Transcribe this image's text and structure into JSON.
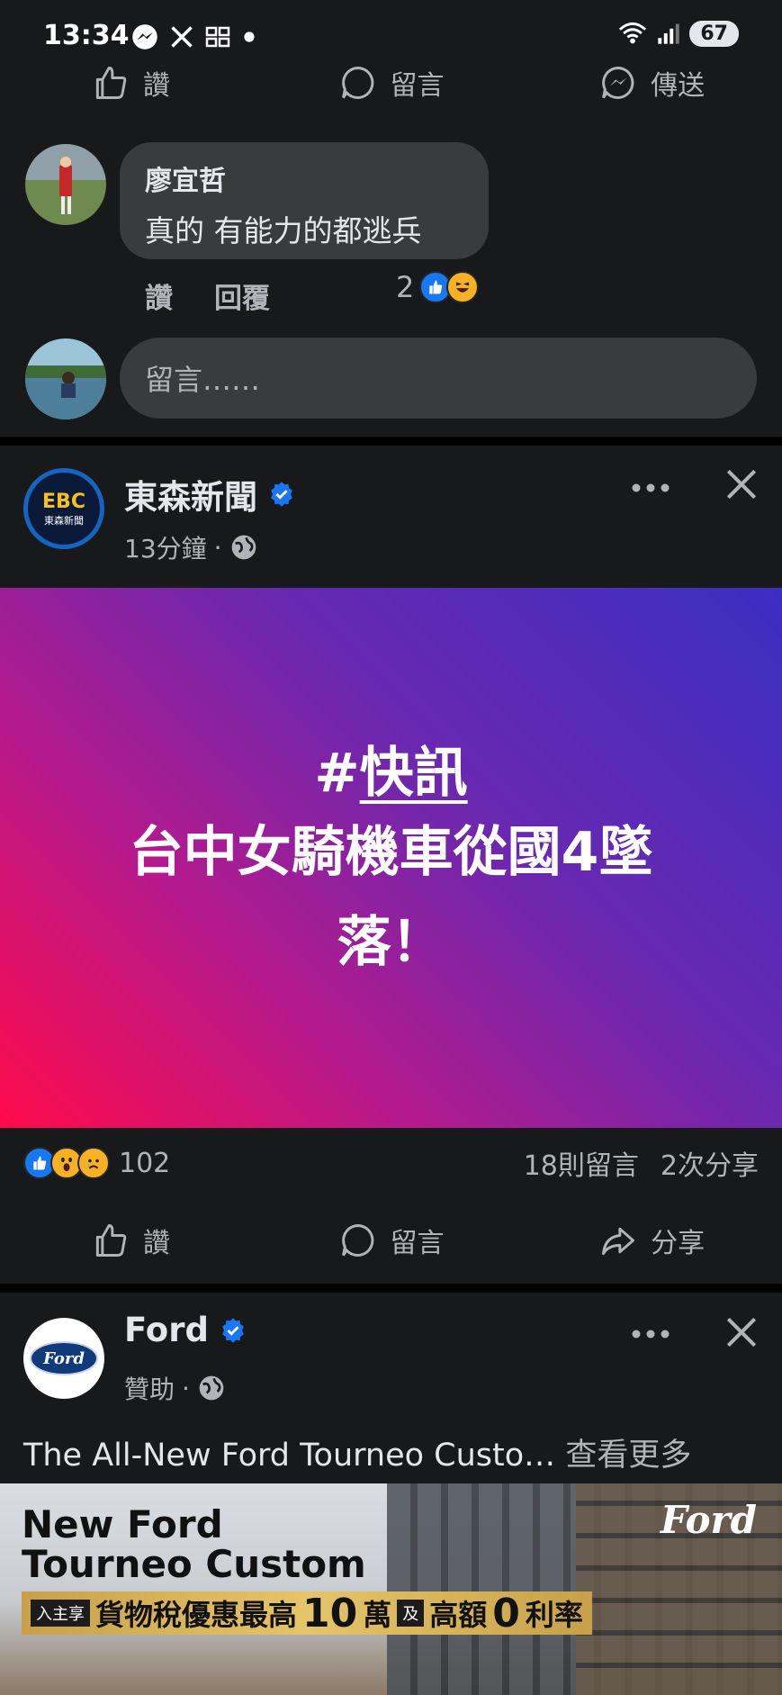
{
  "status_bar": {
    "time": "13:34",
    "battery": "67"
  },
  "top_actions": {
    "like": "讚",
    "comment": "留言",
    "send": "傳送"
  },
  "comment": {
    "author": "廖宜哲",
    "text": "真的 有能力的都逃兵",
    "like_action": "讚",
    "reply_action": "回覆",
    "reaction_count": "2"
  },
  "comment_input": {
    "placeholder": "留言……"
  },
  "post1": {
    "page_name": "東森新聞",
    "time": "13分鐘",
    "logo_text": "EBC",
    "logo_sub": "東森新聞",
    "image_tag_hash": "#",
    "image_tag": "快訊",
    "image_line1": "台中女騎機車從國4墜",
    "image_line2": "落！",
    "reactions_count": "102",
    "comments": "18則留言",
    "shares": "2次分享",
    "actions": {
      "like": "讚",
      "comment": "留言",
      "share": "分享"
    }
  },
  "post2": {
    "page_name": "Ford",
    "meta": "贊助",
    "logo_text": "Ford",
    "text": "The All-New Ford Tourneo Custo…",
    "see_more": "查看更多",
    "ad_title_line1": "New Ford",
    "ad_title_line2": "Tourneo Custom",
    "ad_banner_small1": "入主享",
    "ad_banner_text1": "貨物稅優惠最高",
    "ad_banner_num1": "10",
    "ad_banner_text2": "萬",
    "ad_banner_small2": "及",
    "ad_banner_text3": "高額",
    "ad_banner_num2": "0",
    "ad_banner_text4": "利率",
    "ad_logo": "Ford"
  }
}
